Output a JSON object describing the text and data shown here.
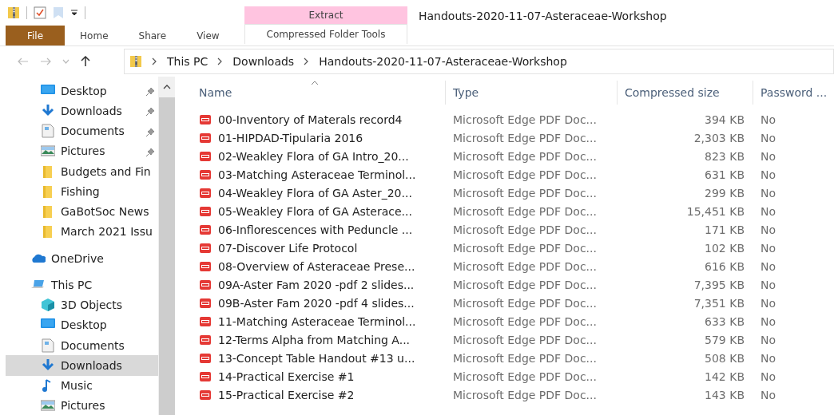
{
  "window": {
    "title": "Handouts-2020-11-07-Asteraceae-Workshop"
  },
  "ribbon": {
    "context_group": "Extract",
    "tabs": [
      {
        "label": "File",
        "kind": "file",
        "selected": false
      },
      {
        "label": "Home",
        "kind": "normal",
        "selected": false
      },
      {
        "label": "Share",
        "kind": "normal",
        "selected": false
      },
      {
        "label": "View",
        "kind": "normal",
        "selected": false
      },
      {
        "label": "Compressed Folder Tools",
        "kind": "contextual",
        "selected": false
      }
    ]
  },
  "address_bar": {
    "path": [
      "This PC",
      "Downloads",
      "Handouts-2020-11-07-Asteraceae-Workshop"
    ]
  },
  "sidebar": {
    "quick_access": [
      {
        "label": "Desktop",
        "kind": "desktop",
        "pinned": true,
        "selected": false
      },
      {
        "label": "Downloads",
        "kind": "download",
        "pinned": true,
        "selected": false
      },
      {
        "label": "Documents",
        "kind": "documents",
        "pinned": true,
        "selected": false
      },
      {
        "label": "Pictures",
        "kind": "pictures",
        "pinned": true,
        "selected": false
      },
      {
        "label": "Budgets and Fin",
        "kind": "folder",
        "pinned": false,
        "selected": false
      },
      {
        "label": "Fishing",
        "kind": "folder",
        "pinned": false,
        "selected": false
      },
      {
        "label": "GaBotSoc News",
        "kind": "folder",
        "pinned": false,
        "selected": false
      },
      {
        "label": "March 2021 Issu",
        "kind": "folder",
        "pinned": false,
        "selected": false
      }
    ],
    "tree": [
      {
        "label": "OneDrive",
        "kind": "cloud",
        "selected": false
      },
      {
        "label": "This PC",
        "kind": "pc",
        "selected": false,
        "children": [
          {
            "label": "3D Objects",
            "kind": "cube",
            "selected": false
          },
          {
            "label": "Desktop",
            "kind": "desktop",
            "selected": false
          },
          {
            "label": "Documents",
            "kind": "documents",
            "selected": false
          },
          {
            "label": "Downloads",
            "kind": "download",
            "selected": true
          },
          {
            "label": "Music",
            "kind": "music",
            "selected": false
          },
          {
            "label": "Pictures",
            "kind": "pictures",
            "selected": false
          }
        ]
      }
    ]
  },
  "table": {
    "columns": [
      "Name",
      "Type",
      "Compressed size",
      "Password ..."
    ],
    "rows": [
      {
        "name": "00-Inventory of Materals record4",
        "type": "Microsoft Edge PDF Doc...",
        "size": "394 KB",
        "password": "No"
      },
      {
        "name": "01-HIPDAD-Tipularia 2016",
        "type": "Microsoft Edge PDF Doc...",
        "size": "2,303 KB",
        "password": "No"
      },
      {
        "name": "02-Weakley Flora of GA Intro_20...",
        "type": "Microsoft Edge PDF Doc...",
        "size": "823 KB",
        "password": "No"
      },
      {
        "name": "03-Matching Asteraceae Terminol...",
        "type": "Microsoft Edge PDF Doc...",
        "size": "631 KB",
        "password": "No"
      },
      {
        "name": "04-Weakley Flora of GA Aster_20...",
        "type": "Microsoft Edge PDF Doc...",
        "size": "299 KB",
        "password": "No"
      },
      {
        "name": "05-Weakley Flora of GA Asterace...",
        "type": "Microsoft Edge PDF Doc...",
        "size": "15,451 KB",
        "password": "No"
      },
      {
        "name": "06-Inflorescences with Peduncle ...",
        "type": "Microsoft Edge PDF Doc...",
        "size": "171 KB",
        "password": "No"
      },
      {
        "name": "07-Discover Life Protocol",
        "type": "Microsoft Edge PDF Doc...",
        "size": "102 KB",
        "password": "No"
      },
      {
        "name": "08-Overview of Asteraceae Prese...",
        "type": "Microsoft Edge PDF Doc...",
        "size": "616 KB",
        "password": "No"
      },
      {
        "name": "09A-Aster Fam 2020 -pdf 2 slides...",
        "type": "Microsoft Edge PDF Doc...",
        "size": "7,395 KB",
        "password": "No"
      },
      {
        "name": "09B-Aster Fam 2020 -pdf 4 slides...",
        "type": "Microsoft Edge PDF Doc...",
        "size": "7,351 KB",
        "password": "No"
      },
      {
        "name": "11-Matching Asteraceae Terminol...",
        "type": "Microsoft Edge PDF Doc...",
        "size": "633 KB",
        "password": "No"
      },
      {
        "name": "12-Terms Alpha from Matching A...",
        "type": "Microsoft Edge PDF Doc...",
        "size": "579 KB",
        "password": "No"
      },
      {
        "name": "13-Concept Table Handout #13 u...",
        "type": "Microsoft Edge PDF Doc...",
        "size": "508 KB",
        "password": "No"
      },
      {
        "name": "14-Practical Exercise #1",
        "type": "Microsoft Edge PDF Doc...",
        "size": "142 KB",
        "password": "No"
      },
      {
        "name": "15-Practical Exercise #2",
        "type": "Microsoft Edge PDF Doc...",
        "size": "143 KB",
        "password": "No"
      }
    ]
  }
}
